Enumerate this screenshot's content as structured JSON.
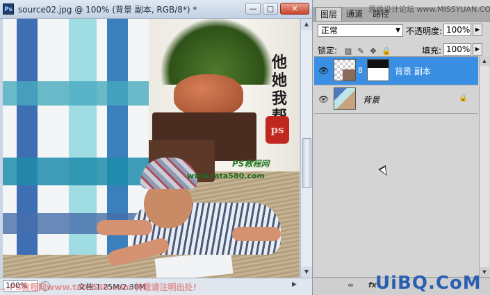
{
  "document": {
    "title": "source02.jpg @ 100% (背景 副本, RGB/8*) *",
    "ps_icon": "Ps",
    "window_buttons": {
      "minimize": "—",
      "maximize": "□",
      "close": "✕"
    },
    "canvas_text": {
      "calligraphy": "他\n她\n我\n帮\n你",
      "seal": "ps",
      "watermark_line1": "PS教程网",
      "watermark_line2": "www.tata580.com"
    },
    "scroll_arrows": {
      "up": "▲",
      "down": "▼",
      "right": "▶"
    },
    "status": {
      "zoom": "100%",
      "doc_info": "文档:1.25M/2.30M"
    },
    "bottom_watermark": "...PS教程网www.tata580.com 转载请注明出处!"
  },
  "layers_panel": {
    "tabs": [
      {
        "label": "图层",
        "active": true
      },
      {
        "label": "通道",
        "active": false
      },
      {
        "label": "路径",
        "active": false
      }
    ],
    "tab_watermark": "思缘设计论坛 www.MISSYUAN.COM",
    "blend_mode": "正常",
    "opacity_label": "不透明度:",
    "opacity_value": "100%",
    "lock_label": "锁定:",
    "lock_icons": [
      "transparency-lock-icon",
      "brush-lock-icon",
      "move-lock-icon",
      "padlock-icon"
    ],
    "lock_glyphs": [
      "▨",
      "✎",
      "✥",
      "🔒"
    ],
    "fill_label": "填充:",
    "fill_value": "100%",
    "arrow_glyph": "▶",
    "dropdown_glyph": "▼",
    "layers": [
      {
        "name": "背景 副本",
        "visible": true,
        "selected": true,
        "has_mask": true
      },
      {
        "name": "背景",
        "visible": true,
        "selected": false,
        "locked": true
      }
    ],
    "eye_glyph": "👁",
    "chain_glyph": "8",
    "lock_badge_glyph": "🔒",
    "bottom_icons": {
      "link": "∞",
      "fx": "fx"
    }
  },
  "branding": {
    "uibq": "UiBQ.CoM"
  },
  "colors": {
    "selected_layer": "#3b8fe3",
    "panel_bg": "#d4d4d4",
    "title_bg": "#c9d6e6"
  }
}
